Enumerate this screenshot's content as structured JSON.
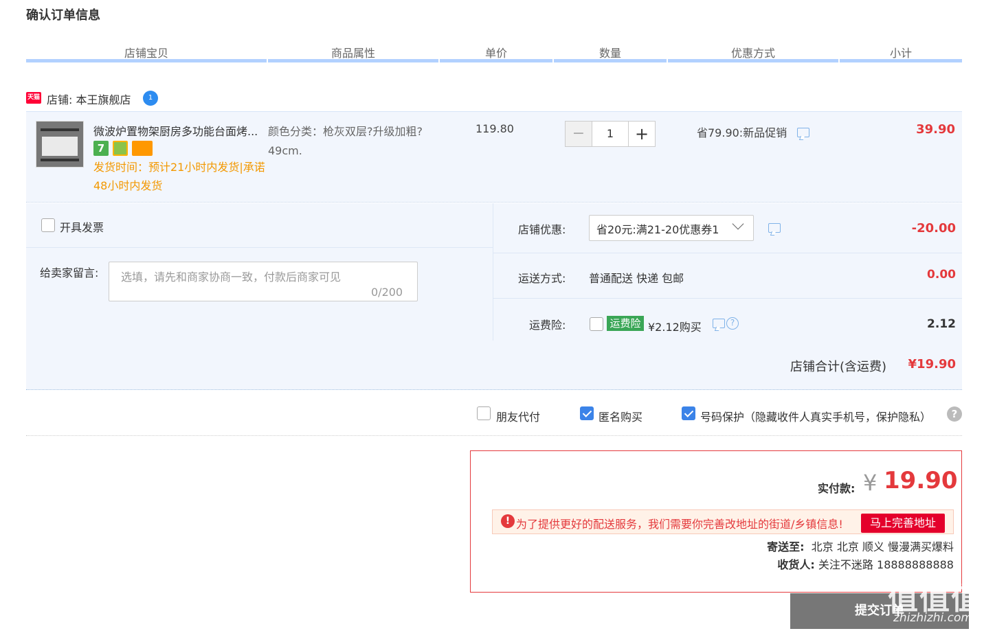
{
  "page_title": "确认订单信息",
  "headers": [
    "店铺宝贝",
    "商品属性",
    "单价",
    "数量",
    "优惠方式",
    "小计"
  ],
  "shop": {
    "badge": "天猫",
    "label": "店铺: 本王旗舰店",
    "ww_badge": "1"
  },
  "item": {
    "title": "微波炉置物架厨房多功能台面烤...",
    "badge_7": "7",
    "shipping": "发货时间：预计21小时内发货|承诺48小时内发货",
    "attr": "颜色分类：枪灰双层?升级加粗?49cm.",
    "price": "119.80",
    "qty": "1",
    "minus": "−",
    "plus": "+",
    "promo": "省79.90:新品促销",
    "subtotal": "39.90"
  },
  "invoice": {
    "label": "开具发票"
  },
  "message": {
    "label": "给卖家留言:",
    "placeholder": "选填，请先和商家协商一致，付款后商家可见",
    "count": "0/200"
  },
  "shop_discount": {
    "label": "店铺优惠:",
    "selected": "省20元:满21-20优惠券1",
    "value": "-20.00"
  },
  "delivery": {
    "label": "运送方式:",
    "text": "普通配送 快递 包邮",
    "value": "0.00"
  },
  "insurance": {
    "label": "运费险:",
    "tag": "运费险",
    "text": "¥2.12购买",
    "help": "?",
    "value": "2.12"
  },
  "shop_total": {
    "label": "店铺合计(含运费)",
    "value": "¥19.90"
  },
  "options": {
    "friend_pay": "朋友代付",
    "anonymous": "匿名购买",
    "privacy": "号码保护（隐藏收件人真实手机号，保护隐私）",
    "help": "?"
  },
  "payment": {
    "label": "实付款:",
    "yen": "¥",
    "amount": "19.90",
    "warn_icon": "!",
    "warn_text": "为了提供更好的配送服务，我们需要你完善改地址的街道/乡镇信息!",
    "warn_button": "马上完善地址",
    "ship_to_label": "寄送至:",
    "ship_to": "北京 北京 顺义 慢漫满买爆料",
    "receiver_label": "收货人:",
    "receiver": "关注不迷路 18888888888"
  },
  "submit": "提交订单",
  "watermark": {
    "text": "值值值",
    "url": "zhizhizhi.com"
  },
  "colors": {
    "accent_red": "#e4393c",
    "header_line": "#b2d1ff",
    "panel_bg": "#f2f6fd",
    "ship_orange": "#f39800"
  }
}
